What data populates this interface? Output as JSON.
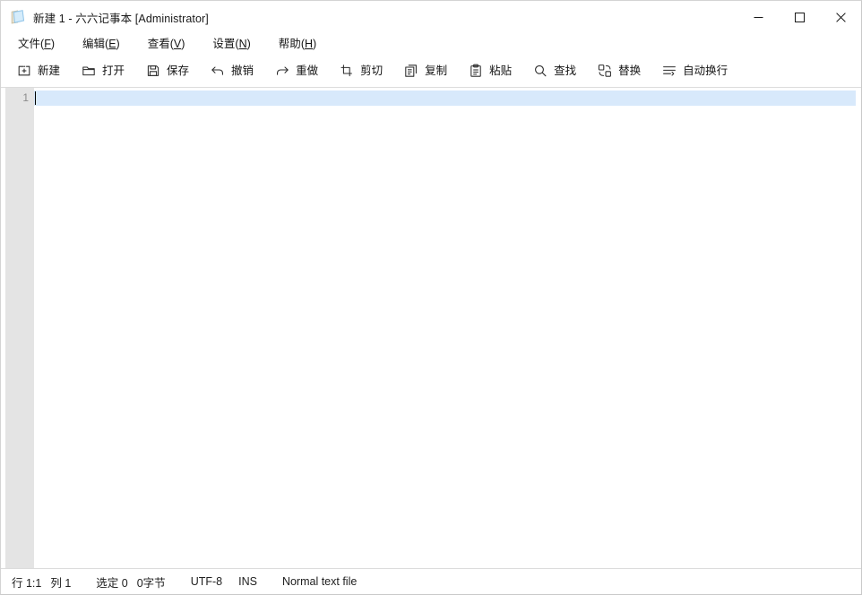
{
  "window": {
    "title": "新建 1 - 六六记事本 [Administrator]",
    "icon": "book-icon",
    "controls": {
      "minimize": "minimize-icon",
      "maximize": "maximize-icon",
      "close": "close-icon"
    }
  },
  "menubar": {
    "items": [
      {
        "label": "文件",
        "accel": "F",
        "name": "menu-file"
      },
      {
        "label": "编辑",
        "accel": "E",
        "name": "menu-edit"
      },
      {
        "label": "查看",
        "accel": "V",
        "name": "menu-view"
      },
      {
        "label": "设置",
        "accel": "N",
        "name": "menu-settings"
      },
      {
        "label": "帮助",
        "accel": "H",
        "name": "menu-help"
      }
    ]
  },
  "toolbar": {
    "items": [
      {
        "label": "新建",
        "icon": "new-file-icon"
      },
      {
        "label": "打开",
        "icon": "open-folder-icon"
      },
      {
        "label": "保存",
        "icon": "save-disk-icon"
      },
      {
        "label": "撤销",
        "icon": "undo-arrow-icon"
      },
      {
        "label": "重做",
        "icon": "redo-arrow-icon"
      },
      {
        "label": "剪切",
        "icon": "cut-icon"
      },
      {
        "label": "复制",
        "icon": "copy-icon"
      },
      {
        "label": "粘贴",
        "icon": "paste-clipboard-icon"
      },
      {
        "label": "查找",
        "icon": "search-icon"
      },
      {
        "label": "替换",
        "icon": "replace-icon"
      },
      {
        "label": "自动换行",
        "icon": "word-wrap-icon"
      }
    ]
  },
  "editor": {
    "line_numbers": [
      "1"
    ],
    "lines": [
      ""
    ],
    "current_line_highlight": "#d8e9fb",
    "gutter_bg": "#e4e4e4"
  },
  "statusbar": {
    "line_col": "行 1:1",
    "column": "列 1",
    "selected": "选定 0",
    "bytes": "0字节",
    "encoding": "UTF-8",
    "insert_mode": "INS",
    "file_type": "Normal text file"
  }
}
